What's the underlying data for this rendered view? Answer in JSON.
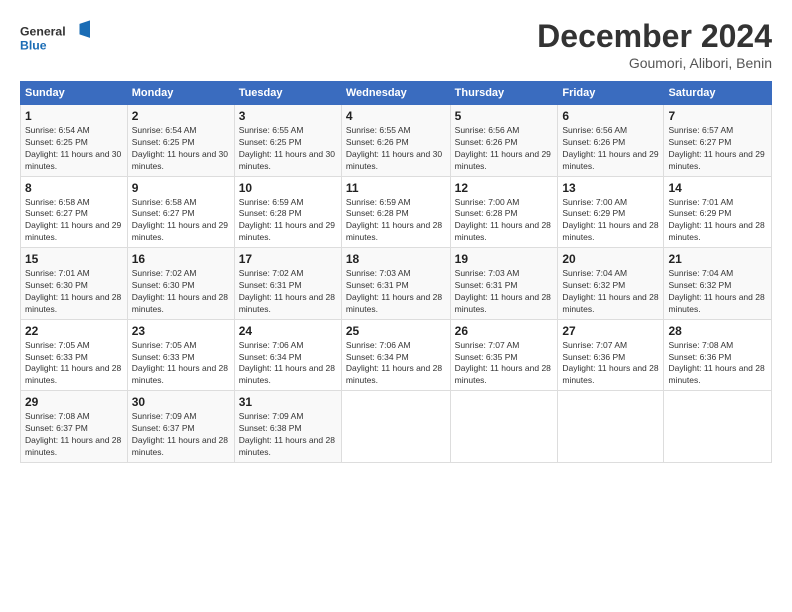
{
  "logo": {
    "line1": "General",
    "line2": "Blue"
  },
  "title": {
    "month": "December 2024",
    "location": "Goumori, Alibori, Benin"
  },
  "weekdays": [
    "Sunday",
    "Monday",
    "Tuesday",
    "Wednesday",
    "Thursday",
    "Friday",
    "Saturday"
  ],
  "weeks": [
    [
      {
        "day": "1",
        "sunrise": "6:54 AM",
        "sunset": "6:25 PM",
        "daylight": "11 hours and 30 minutes."
      },
      {
        "day": "2",
        "sunrise": "6:54 AM",
        "sunset": "6:25 PM",
        "daylight": "11 hours and 30 minutes."
      },
      {
        "day": "3",
        "sunrise": "6:55 AM",
        "sunset": "6:25 PM",
        "daylight": "11 hours and 30 minutes."
      },
      {
        "day": "4",
        "sunrise": "6:55 AM",
        "sunset": "6:26 PM",
        "daylight": "11 hours and 30 minutes."
      },
      {
        "day": "5",
        "sunrise": "6:56 AM",
        "sunset": "6:26 PM",
        "daylight": "11 hours and 29 minutes."
      },
      {
        "day": "6",
        "sunrise": "6:56 AM",
        "sunset": "6:26 PM",
        "daylight": "11 hours and 29 minutes."
      },
      {
        "day": "7",
        "sunrise": "6:57 AM",
        "sunset": "6:27 PM",
        "daylight": "11 hours and 29 minutes."
      }
    ],
    [
      {
        "day": "8",
        "sunrise": "6:58 AM",
        "sunset": "6:27 PM",
        "daylight": "11 hours and 29 minutes."
      },
      {
        "day": "9",
        "sunrise": "6:58 AM",
        "sunset": "6:27 PM",
        "daylight": "11 hours and 29 minutes."
      },
      {
        "day": "10",
        "sunrise": "6:59 AM",
        "sunset": "6:28 PM",
        "daylight": "11 hours and 29 minutes."
      },
      {
        "day": "11",
        "sunrise": "6:59 AM",
        "sunset": "6:28 PM",
        "daylight": "11 hours and 28 minutes."
      },
      {
        "day": "12",
        "sunrise": "7:00 AM",
        "sunset": "6:28 PM",
        "daylight": "11 hours and 28 minutes."
      },
      {
        "day": "13",
        "sunrise": "7:00 AM",
        "sunset": "6:29 PM",
        "daylight": "11 hours and 28 minutes."
      },
      {
        "day": "14",
        "sunrise": "7:01 AM",
        "sunset": "6:29 PM",
        "daylight": "11 hours and 28 minutes."
      }
    ],
    [
      {
        "day": "15",
        "sunrise": "7:01 AM",
        "sunset": "6:30 PM",
        "daylight": "11 hours and 28 minutes."
      },
      {
        "day": "16",
        "sunrise": "7:02 AM",
        "sunset": "6:30 PM",
        "daylight": "11 hours and 28 minutes."
      },
      {
        "day": "17",
        "sunrise": "7:02 AM",
        "sunset": "6:31 PM",
        "daylight": "11 hours and 28 minutes."
      },
      {
        "day": "18",
        "sunrise": "7:03 AM",
        "sunset": "6:31 PM",
        "daylight": "11 hours and 28 minutes."
      },
      {
        "day": "19",
        "sunrise": "7:03 AM",
        "sunset": "6:31 PM",
        "daylight": "11 hours and 28 minutes."
      },
      {
        "day": "20",
        "sunrise": "7:04 AM",
        "sunset": "6:32 PM",
        "daylight": "11 hours and 28 minutes."
      },
      {
        "day": "21",
        "sunrise": "7:04 AM",
        "sunset": "6:32 PM",
        "daylight": "11 hours and 28 minutes."
      }
    ],
    [
      {
        "day": "22",
        "sunrise": "7:05 AM",
        "sunset": "6:33 PM",
        "daylight": "11 hours and 28 minutes."
      },
      {
        "day": "23",
        "sunrise": "7:05 AM",
        "sunset": "6:33 PM",
        "daylight": "11 hours and 28 minutes."
      },
      {
        "day": "24",
        "sunrise": "7:06 AM",
        "sunset": "6:34 PM",
        "daylight": "11 hours and 28 minutes."
      },
      {
        "day": "25",
        "sunrise": "7:06 AM",
        "sunset": "6:34 PM",
        "daylight": "11 hours and 28 minutes."
      },
      {
        "day": "26",
        "sunrise": "7:07 AM",
        "sunset": "6:35 PM",
        "daylight": "11 hours and 28 minutes."
      },
      {
        "day": "27",
        "sunrise": "7:07 AM",
        "sunset": "6:36 PM",
        "daylight": "11 hours and 28 minutes."
      },
      {
        "day": "28",
        "sunrise": "7:08 AM",
        "sunset": "6:36 PM",
        "daylight": "11 hours and 28 minutes."
      }
    ],
    [
      {
        "day": "29",
        "sunrise": "7:08 AM",
        "sunset": "6:37 PM",
        "daylight": "11 hours and 28 minutes."
      },
      {
        "day": "30",
        "sunrise": "7:09 AM",
        "sunset": "6:37 PM",
        "daylight": "11 hours and 28 minutes."
      },
      {
        "day": "31",
        "sunrise": "7:09 AM",
        "sunset": "6:38 PM",
        "daylight": "11 hours and 28 minutes."
      },
      null,
      null,
      null,
      null
    ]
  ]
}
